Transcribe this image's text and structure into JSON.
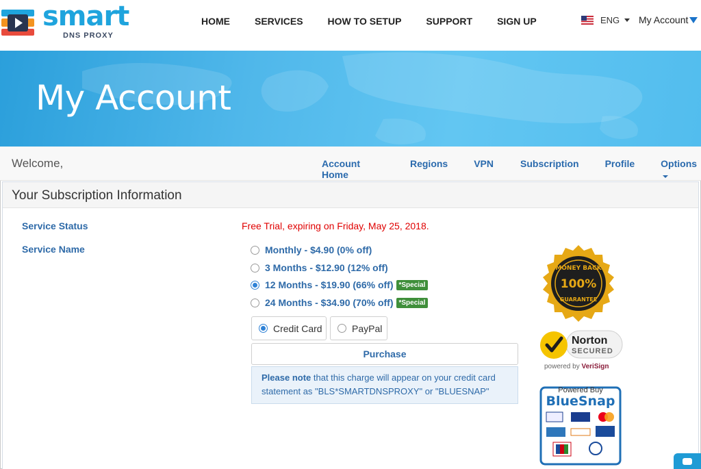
{
  "brand": {
    "name": "smart",
    "sub": "DNS PROXY"
  },
  "nav": {
    "items": [
      "HOME",
      "SERVICES",
      "HOW TO SETUP",
      "SUPPORT",
      "SIGN UP"
    ]
  },
  "lang": {
    "label": "ENG"
  },
  "account": {
    "label": "My Account"
  },
  "hero": {
    "title": "My Account"
  },
  "subnav": {
    "welcome": "Welcome,",
    "links": [
      "Account Home",
      "Regions",
      "VPN",
      "Subscription",
      "Profile",
      "Options"
    ]
  },
  "panel": {
    "title": "Your Subscription Information",
    "status_label": "Service Status",
    "status_value": "Free Trial, expiring on Friday, May 25, 2018.",
    "name_label": "Service Name",
    "plans": [
      {
        "label": "Monthly - $4.90 (0% off)",
        "badge": "",
        "selected": false
      },
      {
        "label": "3 Months - $12.90 (12% off)",
        "badge": "",
        "selected": false
      },
      {
        "label": "12 Months - $19.90 (66% off)",
        "badge": "*Special",
        "selected": true
      },
      {
        "label": "24 Months - $34.90 (70% off)",
        "badge": "*Special",
        "selected": false
      }
    ],
    "payment": {
      "credit": "Credit Card",
      "paypal": "PayPal",
      "selected": "credit"
    },
    "purchase": "Purchase",
    "note_bold": "Please note",
    "note_rest": " that this charge will appear on your credit card statement as \"BLS*SMARTDNSPROXY\" or \"BLUESNAP\""
  },
  "trust": {
    "seal_top": "MONEY BACK",
    "seal_mid": "100%",
    "seal_bottom": "GUARANTEE",
    "norton_name": "Norton",
    "norton_secured": "SECURED",
    "norton_powered": "powered by ",
    "norton_verisign": "VeriSign",
    "bluesnap_powered": "Powered Buy",
    "bluesnap_name": "BlueSnap"
  },
  "colors": {
    "accent": "#2e6aa8",
    "brand": "#1fa4dd",
    "alert": "#e00000",
    "special": "#3f8f3a"
  }
}
